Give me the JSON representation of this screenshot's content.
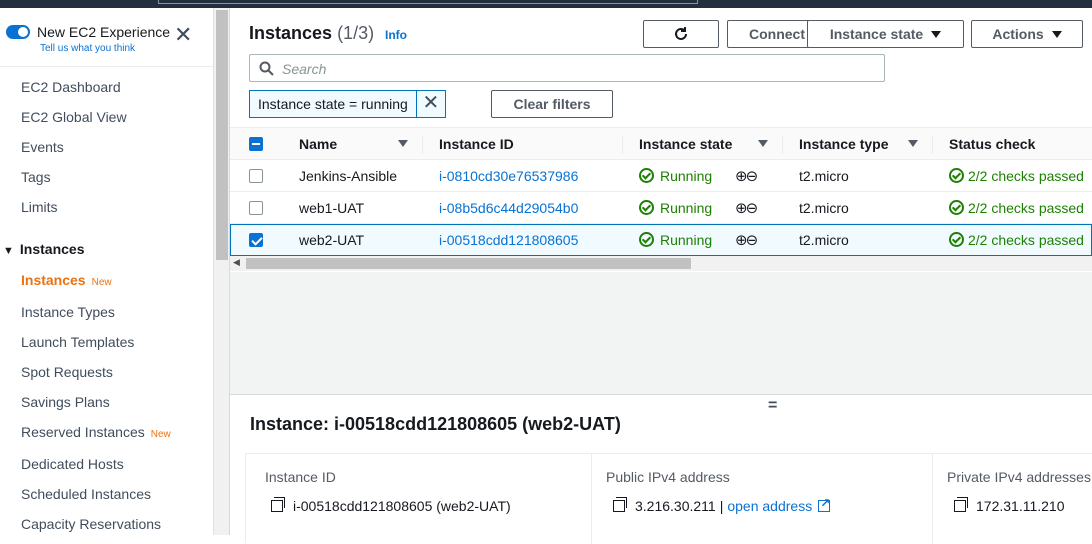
{
  "sidebar": {
    "experience_title": "New EC2 Experience",
    "experience_link": "Tell us what you think",
    "items_top": [
      "EC2 Dashboard",
      "EC2 Global View",
      "Events",
      "Tags",
      "Limits"
    ],
    "section_title": "Instances",
    "items_instances": [
      {
        "label": "Instances",
        "badge": "New",
        "active": true
      },
      {
        "label": "Instance Types"
      },
      {
        "label": "Launch Templates"
      },
      {
        "label": "Spot Requests"
      },
      {
        "label": "Savings Plans"
      },
      {
        "label": "Reserved Instances",
        "badge": "New"
      },
      {
        "label": "Dedicated Hosts"
      },
      {
        "label": "Scheduled Instances"
      },
      {
        "label": "Capacity Reservations"
      }
    ]
  },
  "header": {
    "title": "Instances",
    "count": "(1/3)",
    "info": "Info",
    "connect": "Connect",
    "instance_state": "Instance state",
    "actions": "Actions"
  },
  "search": {
    "placeholder": "Search"
  },
  "filter": {
    "token": "Instance state = running",
    "clear": "Clear filters"
  },
  "table": {
    "columns": [
      "Name",
      "Instance ID",
      "Instance state",
      "Instance type",
      "Status check"
    ],
    "rows": [
      {
        "name": "Jenkins-Ansible",
        "id": "i-0810cd30e76537986",
        "state": "Running",
        "type": "t2.micro",
        "status": "2/2 checks passed",
        "selected": false
      },
      {
        "name": "web1-UAT",
        "id": "i-08b5d6c44d29054b0",
        "state": "Running",
        "type": "t2.micro",
        "status": "2/2 checks passed",
        "selected": false
      },
      {
        "name": "web2-UAT",
        "id": "i-00518cdd121808605",
        "state": "Running",
        "type": "t2.micro",
        "status": "2/2 checks passed",
        "selected": true
      }
    ]
  },
  "details": {
    "handle": "=",
    "title": "Instance: i-00518cdd121808605 (web2-UAT)",
    "fields": [
      {
        "label": "Instance ID",
        "value": "i-00518cdd121808605 (web2-UAT)"
      },
      {
        "label": "Public IPv4 address",
        "value": "3.216.30.211",
        "link": "open address"
      },
      {
        "label": "Private IPv4 addresses",
        "value": "172.31.11.210"
      }
    ]
  },
  "colors": {
    "accent": "#0972d3",
    "running": "#1d8102",
    "active_nav": "#ec7211"
  }
}
